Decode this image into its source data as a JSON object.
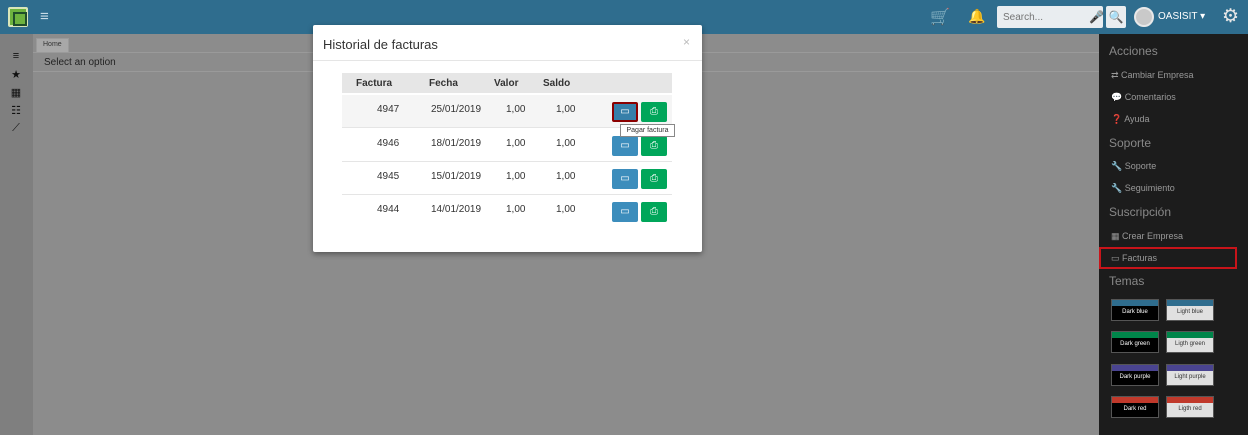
{
  "header": {
    "search_placeholder": "Search...",
    "user_name": "OASISIT",
    "user_caret": "▾",
    "icons": {
      "menu": "≡",
      "cart": "🛒",
      "bell": "🔔",
      "mic": "🎤",
      "search": "🔍",
      "gear": "⚙"
    }
  },
  "left_sidebar": {
    "icons": [
      "≡",
      "★",
      "▦",
      "☷",
      "⟋"
    ]
  },
  "main": {
    "tab_label": "Home",
    "select_placeholder": "Select an option"
  },
  "right_sidebar": {
    "sections": [
      {
        "title": "Acciones",
        "items": [
          "⇄ Cambiar Empresa",
          "💬 Comentarios",
          "❓ Ayuda"
        ]
      },
      {
        "title": "Soporte",
        "items": [
          "🔧 Soporte",
          "🔧 Seguimiento"
        ]
      },
      {
        "title": "Suscripción",
        "items": [
          "▦ Crear Empresa",
          "▭ Facturas"
        ]
      },
      {
        "title": "Temas",
        "items": []
      }
    ],
    "themes": [
      {
        "label": "Dark blue",
        "band": "#2f6d8e",
        "body": "#000000",
        "text": "#ffffff"
      },
      {
        "label": "Light blue",
        "band": "#2f6d8e",
        "body": "#e0e0e0",
        "text": "#333333"
      },
      {
        "label": "Dark green",
        "band": "#00854a",
        "body": "#000000",
        "text": "#ffffff"
      },
      {
        "label": "Ligth green",
        "band": "#00854a",
        "body": "#e0e0e0",
        "text": "#333333"
      },
      {
        "label": "Dark purple",
        "band": "#4a4490",
        "body": "#000000",
        "text": "#ffffff"
      },
      {
        "label": "Light purple",
        "band": "#4a4490",
        "body": "#e0e0e0",
        "text": "#333333"
      },
      {
        "label": "Dark red",
        "band": "#c0392b",
        "body": "#000000",
        "text": "#ffffff"
      },
      {
        "label": "Ligth red",
        "band": "#c0392b",
        "body": "#e0e0e0",
        "text": "#333333"
      }
    ]
  },
  "modal": {
    "title": "Historial de facturas",
    "close": "×",
    "columns": [
      "Factura",
      "Fecha",
      "Valor",
      "Saldo"
    ],
    "rows": [
      {
        "factura": "4947",
        "fecha": "25/01/2019",
        "valor": "1,00",
        "saldo": "1,00"
      },
      {
        "factura": "4946",
        "fecha": "18/01/2019",
        "valor": "1,00",
        "saldo": "1,00"
      },
      {
        "factura": "4945",
        "fecha": "15/01/2019",
        "valor": "1,00",
        "saldo": "1,00"
      },
      {
        "factura": "4944",
        "fecha": "14/01/2019",
        "valor": "1,00",
        "saldo": "1,00"
      }
    ],
    "pay_icon": "▭",
    "print_icon": "⎙",
    "tooltip": "Pagar factura"
  },
  "colors": {
    "topbar": "#2f6d8e",
    "pay_button": "#3c8dbc",
    "print_button": "#00a65a",
    "highlight": "#c8141a"
  }
}
